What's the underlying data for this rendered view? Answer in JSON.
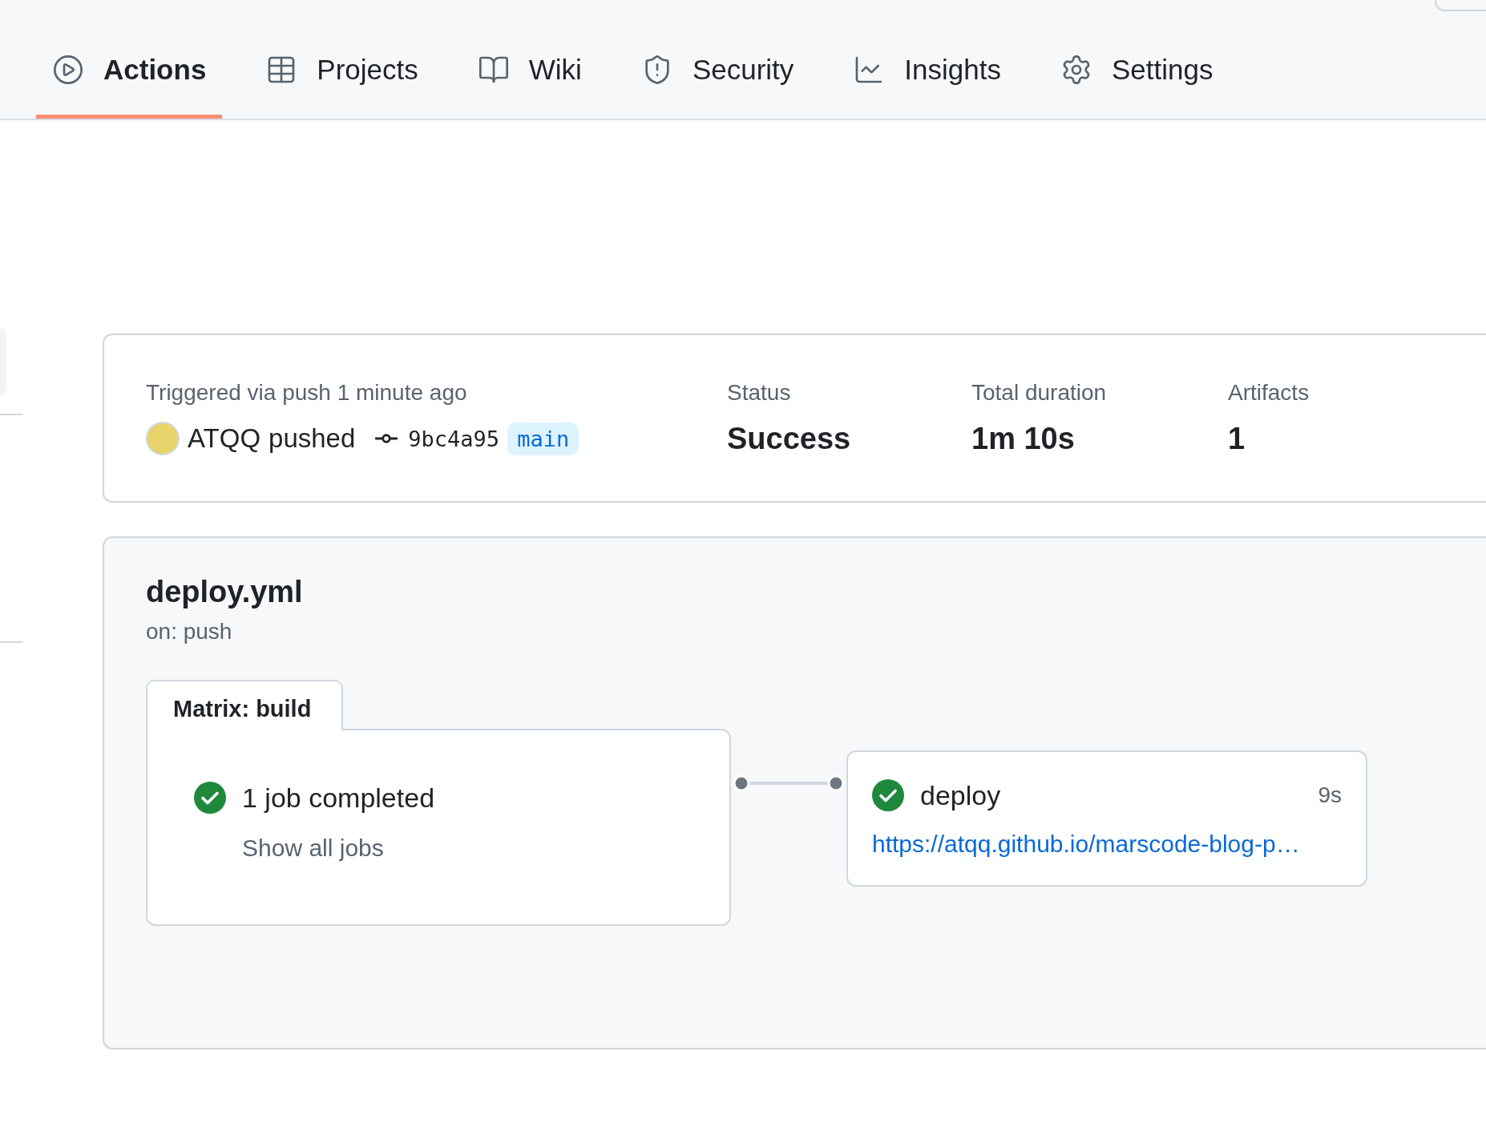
{
  "tabs": [
    {
      "label": "Actions",
      "selected": true
    },
    {
      "label": "Projects",
      "selected": false
    },
    {
      "label": "Wiki",
      "selected": false
    },
    {
      "label": "Security",
      "selected": false
    },
    {
      "label": "Insights",
      "selected": false
    },
    {
      "label": "Settings",
      "selected": false
    }
  ],
  "run_summary": {
    "trigger": "Triggered via push 1 minute ago",
    "actor": "ATQQ",
    "action": "pushed",
    "commit": "9bc4a95",
    "branch": "main",
    "stats": [
      {
        "label": "Status",
        "value": "Success"
      },
      {
        "label": "Total duration",
        "value": "1m 10s"
      },
      {
        "label": "Artifacts",
        "value": "1"
      }
    ]
  },
  "workflow": {
    "name": "deploy.yml",
    "trigger": "on: push",
    "jobs": [
      {
        "kind": "matrix",
        "title": "Matrix: build",
        "summary": "1 job completed",
        "succeeded": true,
        "link": "Show all jobs"
      },
      {
        "kind": "job",
        "name": "deploy",
        "succeeded": true,
        "duration": "9s",
        "link": "https://atqq.github.io/marscode-blog-p…"
      }
    ]
  }
}
